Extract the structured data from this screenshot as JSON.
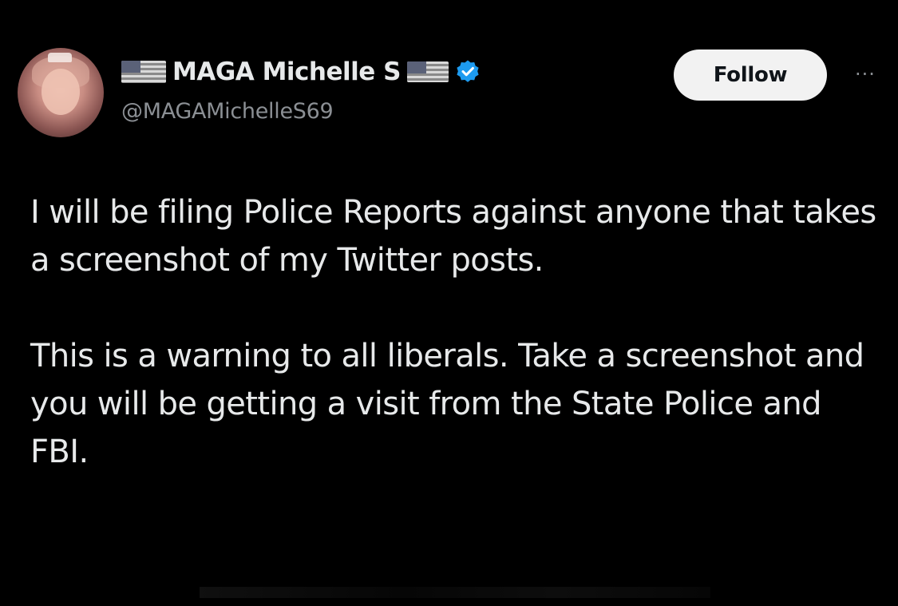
{
  "author": {
    "display_name": "MAGA Michelle S",
    "handle": "@MAGAMichelleS69",
    "verified": true,
    "flag_icon": "us-flag-icon",
    "verified_color": "#1d9bf0"
  },
  "actions": {
    "follow_label": "Follow",
    "more_label": "···"
  },
  "tweet": {
    "paragraphs": [
      "I will be filing Police Reports against anyone that takes a screenshot of my Twitter posts.",
      "This is a warning to all liberals. Take a screenshot and you will be getting a visit from the State Police and FBI."
    ]
  },
  "colors": {
    "background": "#000000",
    "text": "#e7e9ea",
    "secondary_text": "#8b8f94",
    "follow_button_bg": "#f2f2f2"
  }
}
